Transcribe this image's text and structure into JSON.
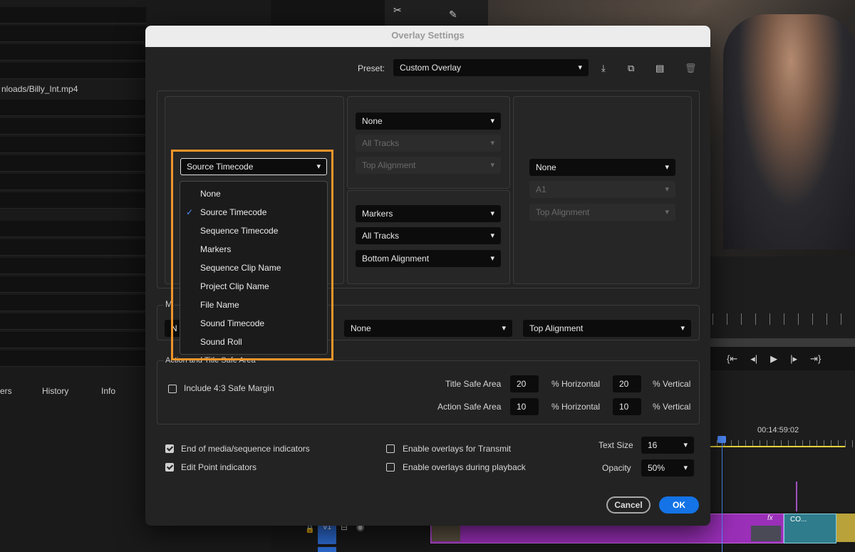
{
  "background": {
    "path_text": "nloads/Billy_Int.mp4",
    "panel_tabs": [
      "ers",
      "History",
      "Info"
    ],
    "timeline_timecode": "00:14:59:02",
    "track_label": "V1",
    "clip_label": "CO...",
    "fx_label": "fx"
  },
  "dialog": {
    "title": "Overlay Settings",
    "preset_label": "Preset:",
    "preset_value": "Custom Overlay",
    "preset_icons": [
      "import-icon",
      "export-icon",
      "folder-icon",
      "trash-icon"
    ],
    "left_dropdown": "Source Timecode",
    "top_center": {
      "overlay": "None",
      "tracks": "All Tracks",
      "alignment": "Top Alignment"
    },
    "bottom_center": {
      "overlay": "Markers",
      "tracks": "All Tracks",
      "alignment": "Bottom Alignment"
    },
    "right": {
      "overlay": "None",
      "tracks": "A1",
      "alignment": "Top Alignment"
    },
    "middle_group_title": "M",
    "middle_row": {
      "left_partial": "N",
      "center": "None",
      "right": "Top Alignment"
    },
    "safe_group_title": "Action and Title Safe Area",
    "include_43": "Include 4:3 Safe Margin",
    "title_safe_label": "Title Safe Area",
    "title_safe_h": "20",
    "title_safe_v": "20",
    "action_safe_label": "Action Safe Area",
    "action_safe_h": "10",
    "action_safe_v": "10",
    "pct_horizontal": "% Horizontal",
    "pct_vertical": "% Vertical",
    "end_media": "End of media/sequence indicators",
    "edit_point": "Edit Point indicators",
    "enable_transmit": "Enable overlays for Transmit",
    "enable_playback": "Enable overlays during playback",
    "text_size_label": "Text Size",
    "text_size_value": "16",
    "opacity_label": "Opacity",
    "opacity_value": "50%",
    "cancel": "Cancel",
    "ok": "OK",
    "checkbox_states": {
      "include_43": false,
      "end_media": true,
      "edit_point": true,
      "enable_transmit": false,
      "enable_playback": false
    }
  },
  "menu": {
    "items": [
      "None",
      "Source Timecode",
      "Sequence Timecode",
      "Markers",
      "Sequence Clip Name",
      "Project Clip Name",
      "File Name",
      "Sound Timecode",
      "Sound Roll"
    ],
    "selected": "Source Timecode",
    "highlight_color": "#f0952a"
  },
  "colors": {
    "accent": "#1473e6",
    "check": "#4f8dff",
    "highlight": "#f0952a"
  }
}
